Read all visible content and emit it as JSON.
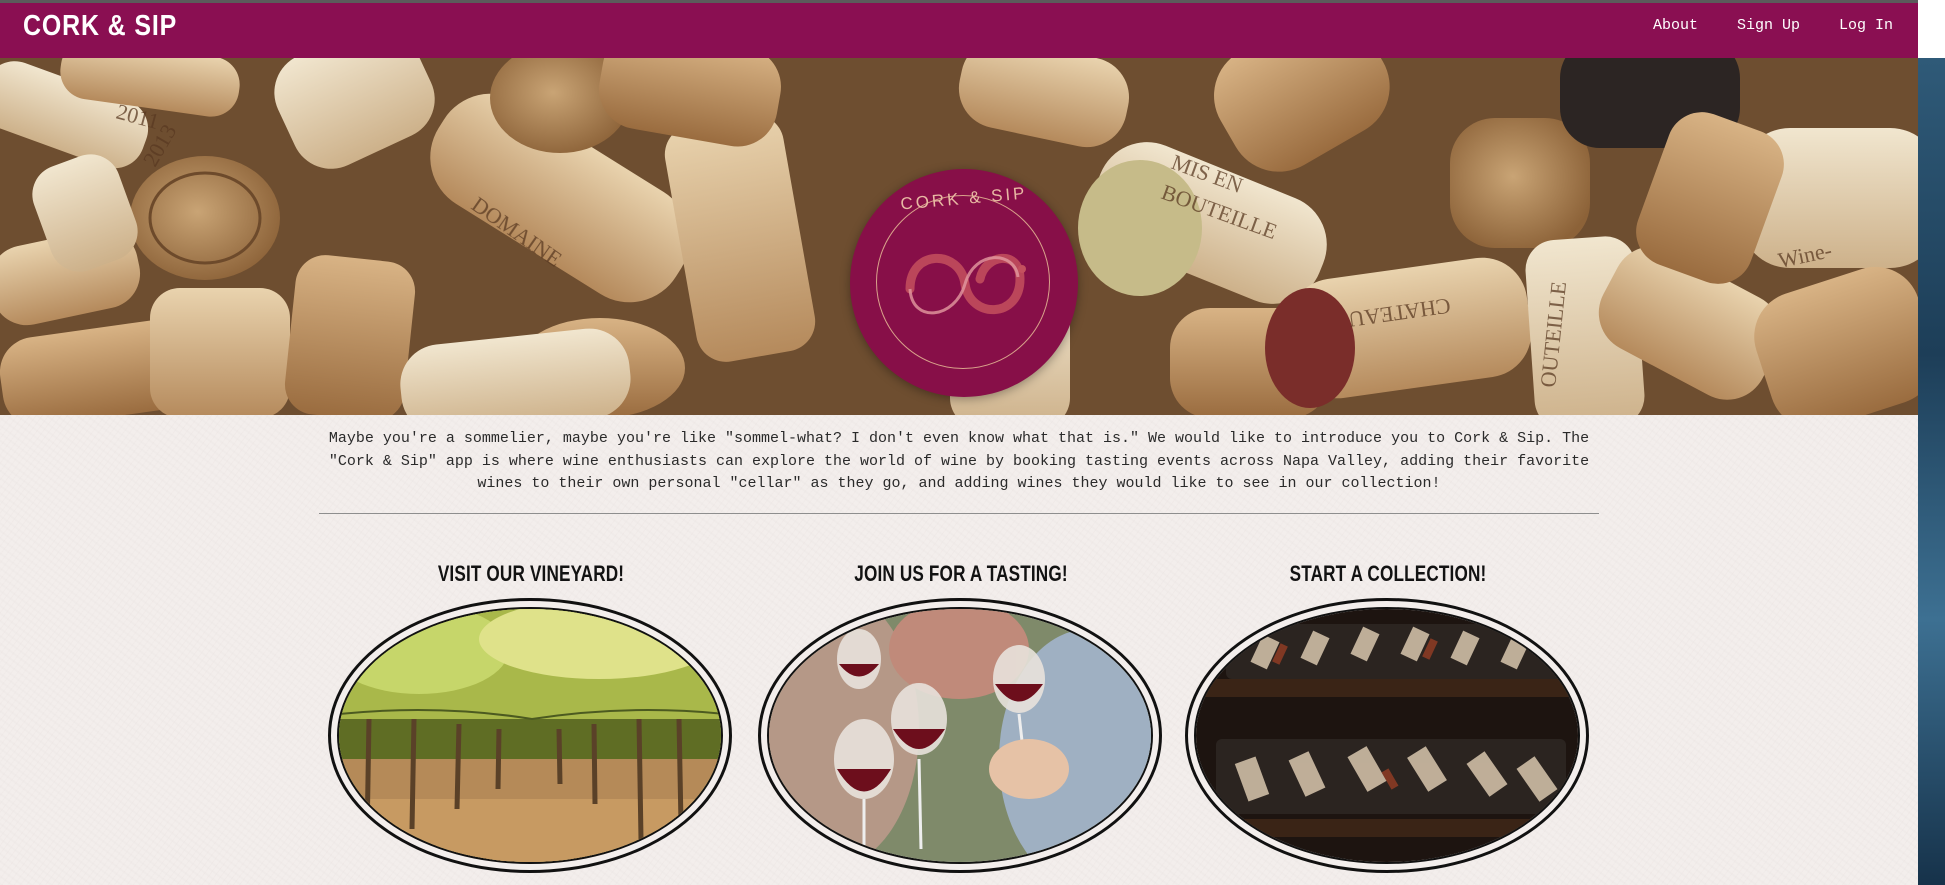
{
  "navbar": {
    "brand": "CORK & SIP",
    "links": [
      "About",
      "Sign Up",
      "Log In"
    ]
  },
  "hero": {
    "logo_text": "CORK & SIP"
  },
  "intro": {
    "text": "Maybe you're a sommelier, maybe you're like \"sommel-what? I don't even know what that is.\" We would like to introduce you to Cork & Sip. The \"Cork & Sip\" app is where wine enthusiasts can explore the world of wine by booking tasting events across Napa Valley, adding their favorite wines to their own personal \"cellar\" as they go, and adding wines they would like to see in our collection!"
  },
  "cards": [
    {
      "title": "VISIT OUR VINEYARD!"
    },
    {
      "title": "JOIN US FOR A TASTING!"
    },
    {
      "title": "START A COLLECTION!"
    }
  ],
  "colors": {
    "brand": "#8a0f52",
    "logo_badge": "#870f48",
    "page_bg": "#f3eeec"
  }
}
